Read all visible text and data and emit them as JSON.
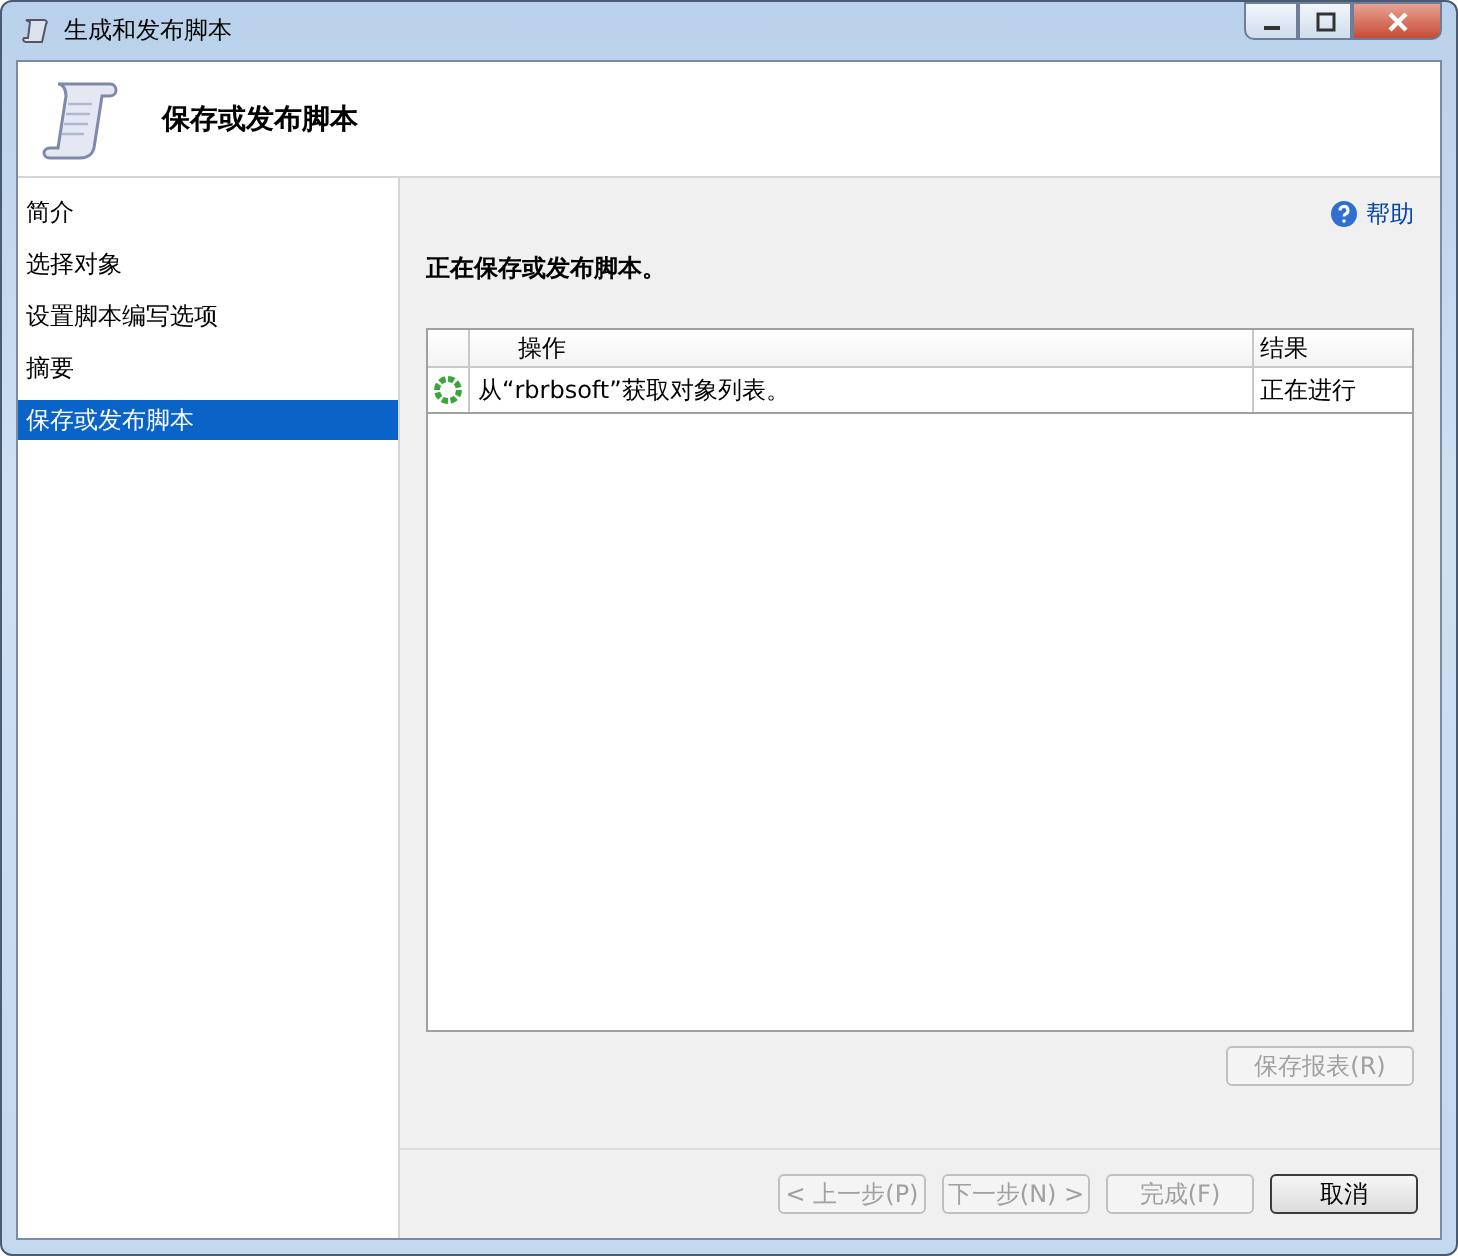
{
  "window": {
    "title": "生成和发布脚本"
  },
  "header": {
    "title": "保存或发布脚本"
  },
  "sidebar": {
    "items": [
      {
        "label": "简介",
        "selected": false
      },
      {
        "label": "选择对象",
        "selected": false
      },
      {
        "label": "设置脚本编写选项",
        "selected": false
      },
      {
        "label": "摘要",
        "selected": false
      },
      {
        "label": "保存或发布脚本",
        "selected": true
      }
    ]
  },
  "help_link": "帮助",
  "status_heading": "正在保存或发布脚本。",
  "table": {
    "columns": [
      "操作",
      "结果"
    ],
    "rows": [
      {
        "action": "从“rbrbsoft”获取对象列表。",
        "result": "正在进行"
      }
    ]
  },
  "save_report_button": {
    "label": "保存报表(R)",
    "disabled": true
  },
  "buttons": [
    {
      "label": "< 上一步(P)",
      "disabled": true
    },
    {
      "label": "下一步(N) >",
      "disabled": true
    },
    {
      "label": "完成(F)",
      "disabled": true
    },
    {
      "label": "取消",
      "disabled": false
    }
  ]
}
